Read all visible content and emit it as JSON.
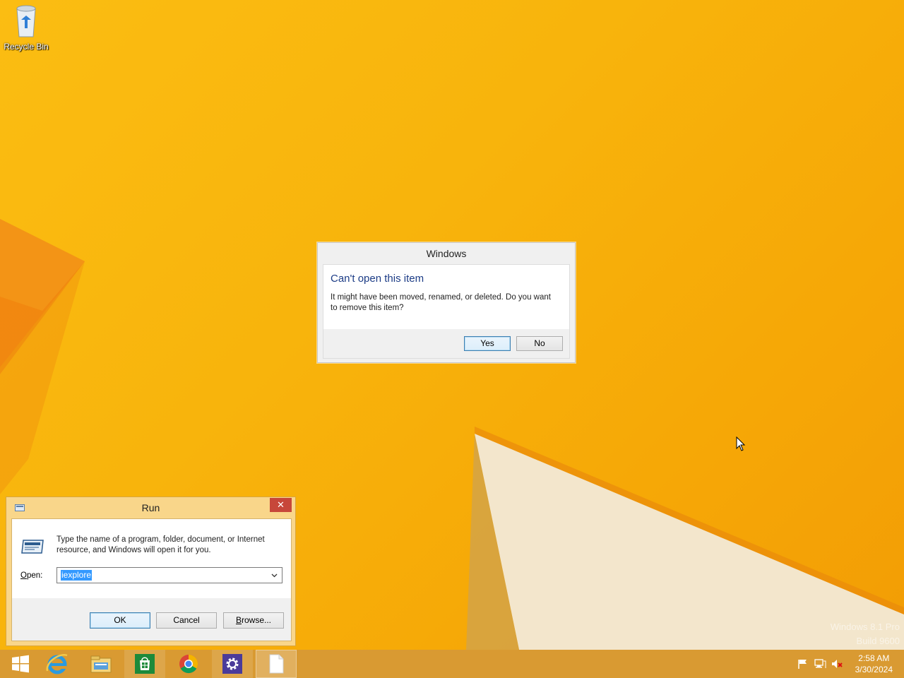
{
  "desktop": {
    "icons": [
      {
        "label": "Recycle Bin"
      }
    ],
    "watermark": {
      "line1": "Windows 8.1 Pro",
      "line2": "Build 9600"
    }
  },
  "message_box": {
    "title": "Windows",
    "heading": "Can't open this item",
    "body_line1": "It might have been moved, renamed, or deleted. Do you want",
    "body_line2": "to remove this item?",
    "yes_label": "Yes",
    "no_label": "No"
  },
  "run_dialog": {
    "title": "Run",
    "close_glyph": "✕",
    "description_line1": "Type the name of a program, folder, document, or Internet",
    "description_line2": "resource, and Windows will open it for you.",
    "open_label_underlined": "O",
    "open_label_rest": "pen:",
    "open_value": "iexplore",
    "ok_label": "OK",
    "cancel_label": "Cancel",
    "browse_label_underlined": "B",
    "browse_label_rest": "rowse..."
  },
  "taskbar": {
    "items": [
      {
        "icon": "start-icon"
      },
      {
        "icon": "internet-explorer-icon"
      },
      {
        "icon": "file-explorer-icon"
      },
      {
        "icon": "store-icon"
      },
      {
        "icon": "chrome-icon"
      },
      {
        "icon": "settings-icon"
      },
      {
        "icon": "blank-document-icon"
      }
    ],
    "tray_icons": [
      "flag-icon",
      "network-icon",
      "volume-muted-icon"
    ],
    "clock": {
      "time": "2:58 AM",
      "date": "3/30/2024"
    }
  },
  "colors": {
    "accent": "#f8b40c",
    "taskbar": "#d99a32",
    "dialog_heading": "#1c3c86",
    "close_button": "#c7473a",
    "selection": "#3399ff"
  }
}
